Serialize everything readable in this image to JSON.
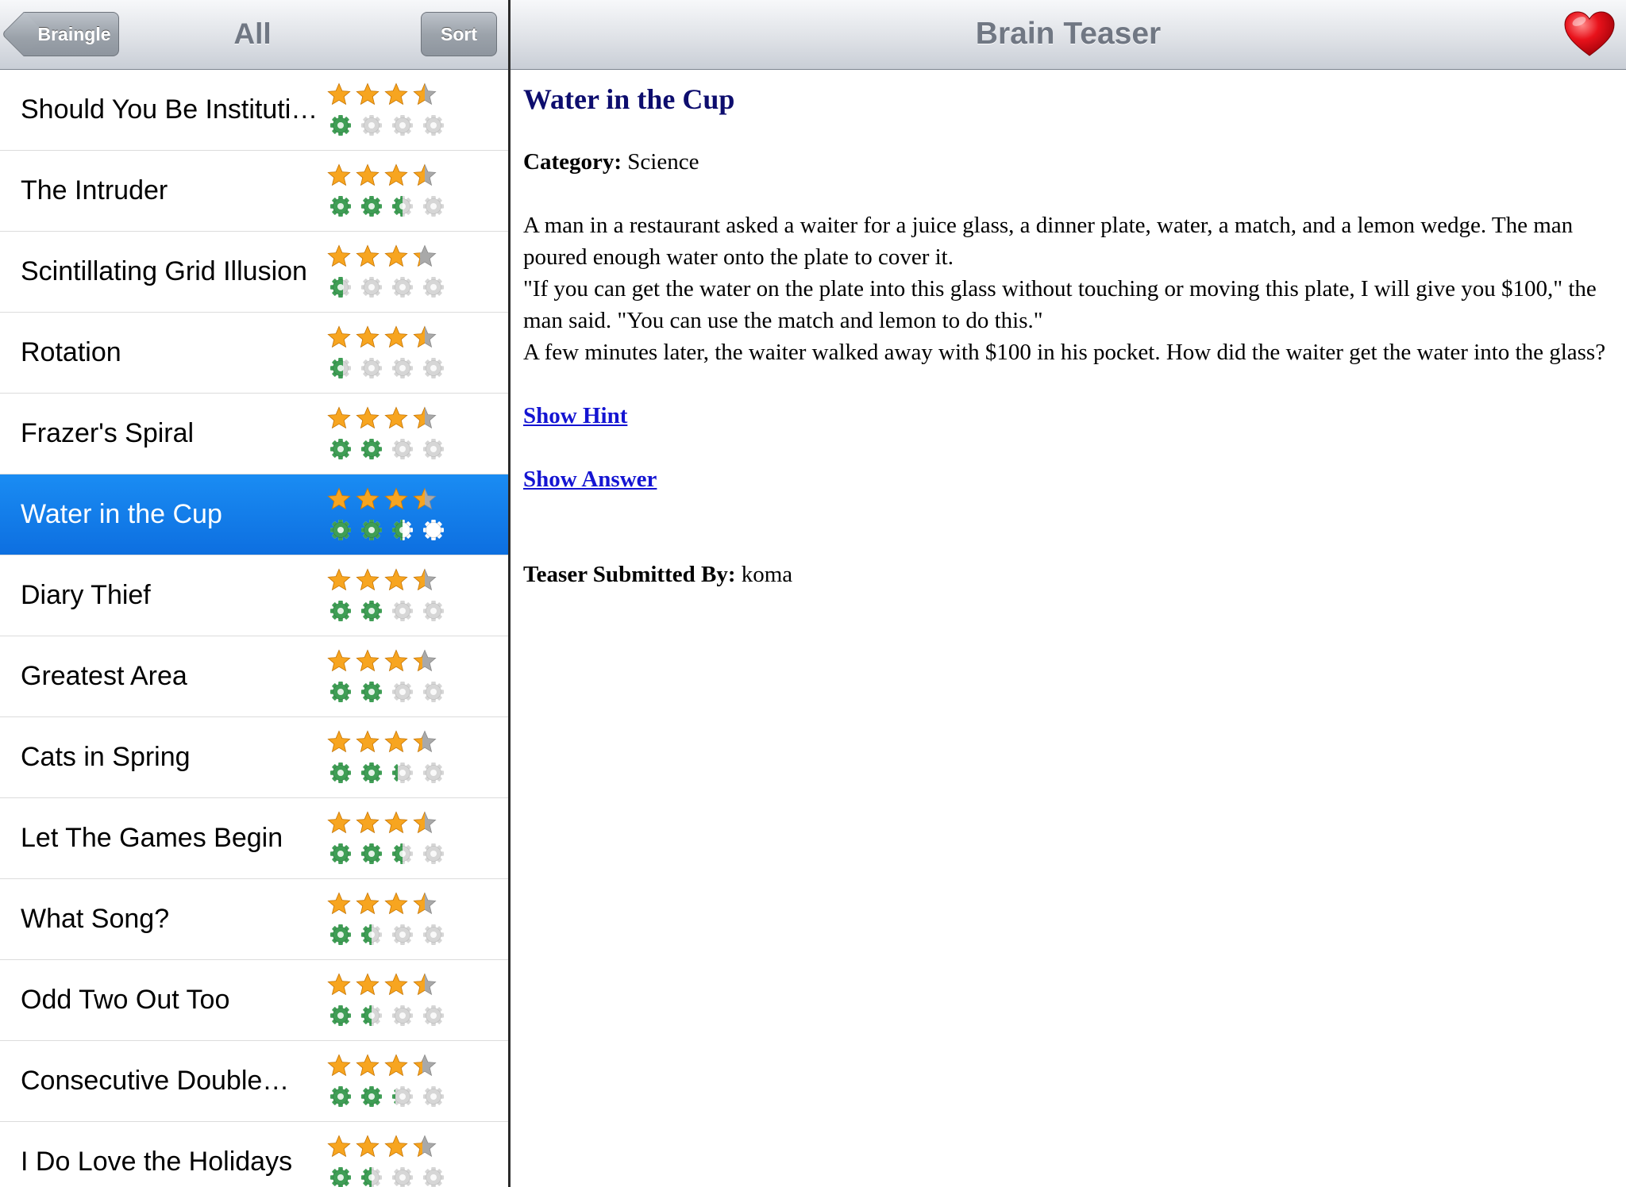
{
  "master": {
    "title": "All",
    "back_label": "Braingle",
    "sort_label": "Sort",
    "selected_index": 5,
    "items": [
      {
        "title": "Should You Be Instituti…",
        "rating": 3.5,
        "difficulty": 1
      },
      {
        "title": "The Intruder",
        "rating": 3.5,
        "difficulty": 2.5
      },
      {
        "title": "Scintillating Grid Illusion",
        "rating": 3.3,
        "difficulty": 0.6
      },
      {
        "title": "Rotation",
        "rating": 3.5,
        "difficulty": 0.6
      },
      {
        "title": "Frazer's Spiral",
        "rating": 3.5,
        "difficulty": 2
      },
      {
        "title": "Water in the Cup",
        "rating": 3.5,
        "difficulty": 2.5
      },
      {
        "title": "Diary Thief",
        "rating": 3.5,
        "difficulty": 2
      },
      {
        "title": "Greatest Area",
        "rating": 3.4,
        "difficulty": 2
      },
      {
        "title": "Cats in Spring",
        "rating": 3.4,
        "difficulty": 2.3
      },
      {
        "title": "Let The Games Begin",
        "rating": 3.5,
        "difficulty": 2.5
      },
      {
        "title": "What Song?",
        "rating": 3.5,
        "difficulty": 1.5
      },
      {
        "title": "Odd Two Out Too",
        "rating": 3.5,
        "difficulty": 1.5
      },
      {
        "title": "Consecutive Double…",
        "rating": 3.4,
        "difficulty": 2.2
      },
      {
        "title": "I Do Love the Holidays",
        "rating": 3.4,
        "difficulty": 1.5
      }
    ]
  },
  "detail": {
    "nav_title": "Brain Teaser",
    "favorite_icon": "heart-icon",
    "teaser_title": "Water in the Cup",
    "category_label": "Category:",
    "category_value": "Science",
    "body_lines": [
      "A man in a restaurant asked a waiter for a juice glass, a dinner plate, water, a match, and a lemon wedge. The man poured enough water onto the plate to cover it.",
      "\"If you can get the water on the plate into this glass without touching or moving this plate, I will give you $100,\" the man said. \"You can use the match and lemon to do this.\"",
      "A few minutes later, the waiter walked away with $100 in his pocket. How did the waiter get the water into the glass?"
    ],
    "show_hint": "Show Hint",
    "show_answer": "Show Answer",
    "submitted_label": "Teaser Submitted By:",
    "submitted_value": "koma"
  },
  "colors": {
    "selection": "#0d6fe0",
    "star_fill": "#f7a520",
    "star_empty": "#a9a9a9",
    "gear_fill": "#3f9e55",
    "gear_empty": "#d6d6d6",
    "heading": "#0d0d6e",
    "link": "#1414d2"
  }
}
